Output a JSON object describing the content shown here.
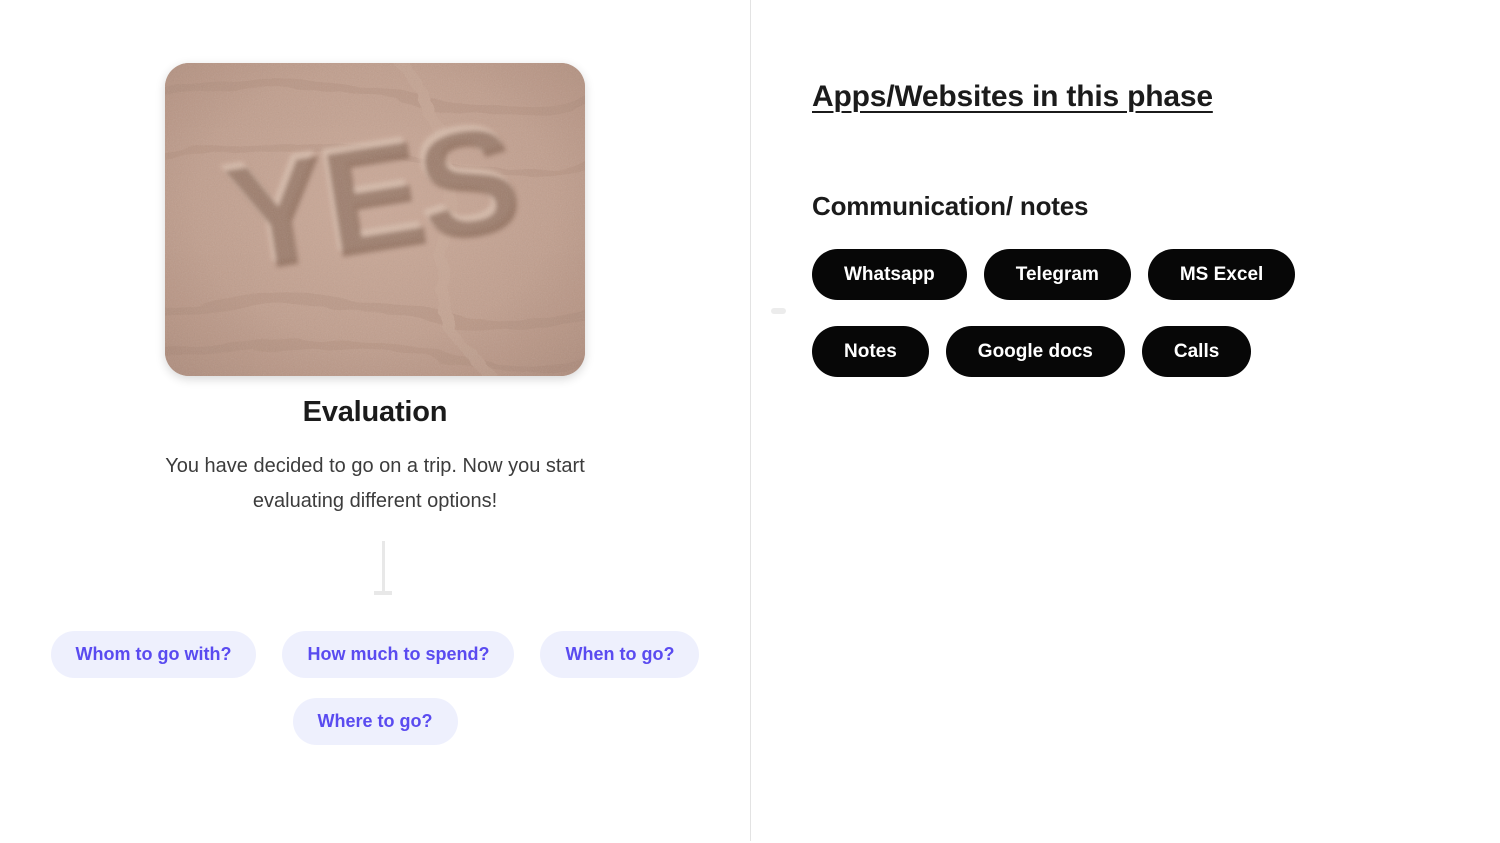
{
  "left_pane": {
    "image": {
      "alt": "YES written in sand",
      "word_in_sand": "YES",
      "sand_color": "#c2a08f"
    },
    "title": "Evaluation",
    "description": "You have decided to go on a trip. Now you start evaluating different options!",
    "question_rows": [
      [
        "Whom to go with?",
        "How much to spend?",
        "When to go?"
      ],
      [
        "Where to go?"
      ]
    ],
    "question_pill_bg": "#eef0fd",
    "question_pill_text_color": "#5a4bf0"
  },
  "right_pane": {
    "heading": "Apps/Websites in this phase",
    "category": "Communication/ notes",
    "app_rows": [
      [
        "Whatsapp",
        "Telegram",
        "MS Excel"
      ],
      [
        "Notes",
        "Google docs",
        "Calls"
      ]
    ],
    "app_pill_bg": "#070707",
    "app_pill_text_color": "#ffffff"
  }
}
